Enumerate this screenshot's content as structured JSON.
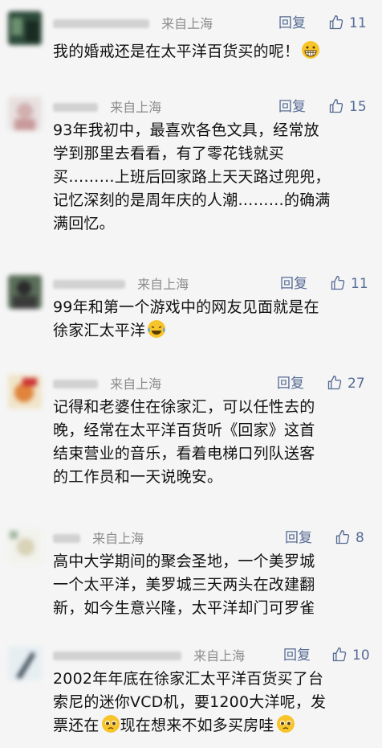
{
  "comments": [
    {
      "location": "来自上海",
      "reply": "回复",
      "likes": "11",
      "text": "我的婚戒还是在太平洋百货买的呢！",
      "emoji": "grinning-face-emoji"
    },
    {
      "location": "来自上海",
      "reply": "回复",
      "likes": "15",
      "text": "93年我初中，最喜欢各色文具，经常放\n学到那里去看看，有了零花钱就买\n买………上班后回家路上天天路过兜兜，\n记忆深刻的是周年庆的人潮………的确满\n满回忆。"
    },
    {
      "location": "来自上海",
      "reply": "回复",
      "likes": "11",
      "text": "99年和第一个游戏中的网友见面就是在\n徐家汇太平洋",
      "emoji": "crying-laughing-face-emoji"
    },
    {
      "location": "来自上海",
      "reply": "回复",
      "likes": "27",
      "text": "记得和老婆住在徐家汇，可以任性去的\n晚，经常在太平洋百货听《回家》这首\n结束营业的音乐，看着电梯口列队送客\n的工作员和一天说晚安。"
    },
    {
      "location": "来自上海",
      "reply": "回复",
      "likes": "8",
      "text": "高中大学期间的聚会圣地，一个美罗城\n一个太平洋，美罗城三天两头在改建翻\n新，如今生意兴隆，太平洋却门可罗雀"
    },
    {
      "location": "来自上海",
      "reply": "回复",
      "likes": "10",
      "text_a": "2002年年底在徐家汇太平洋百货买了台\n索尼的迷你VCD机，要1200大洋呢，发\n票还在",
      "text_b": "现在想来不如多买房哇",
      "emoji": "pleading-face-emoji"
    }
  ],
  "colors": {
    "accent": "#576b95",
    "background": "#f5f5f5",
    "location": "#8c8c8c"
  }
}
